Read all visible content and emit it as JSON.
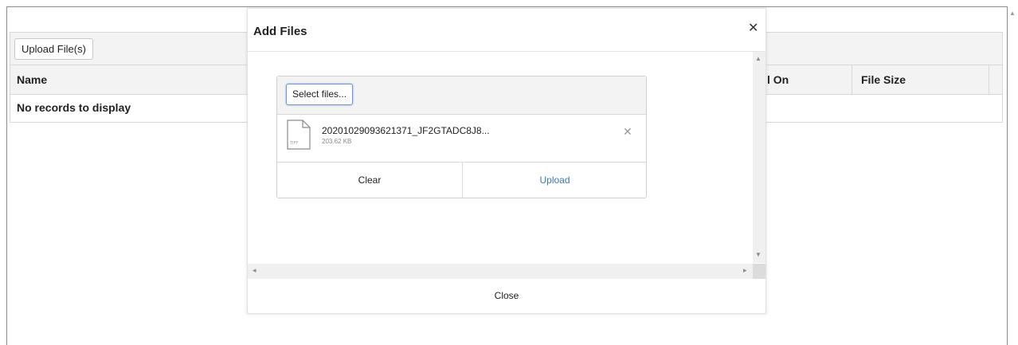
{
  "grid": {
    "upload_label": "Upload File(s)",
    "columns": {
      "name": "Name",
      "uploaded_on": "l On",
      "file_size": "File Size"
    },
    "empty_text": "No records to display"
  },
  "modal": {
    "title": "Add Files",
    "close_icon": "close-icon",
    "footer_close": "Close",
    "uploader": {
      "select_label": "Select files...",
      "file": {
        "name": "20201029093621371_JF2GTADC8J8...",
        "size": "203.62 KB",
        "type_badge": "TIFF"
      },
      "clear_label": "Clear",
      "upload_label": "Upload",
      "accent": "#3a78c2"
    }
  }
}
